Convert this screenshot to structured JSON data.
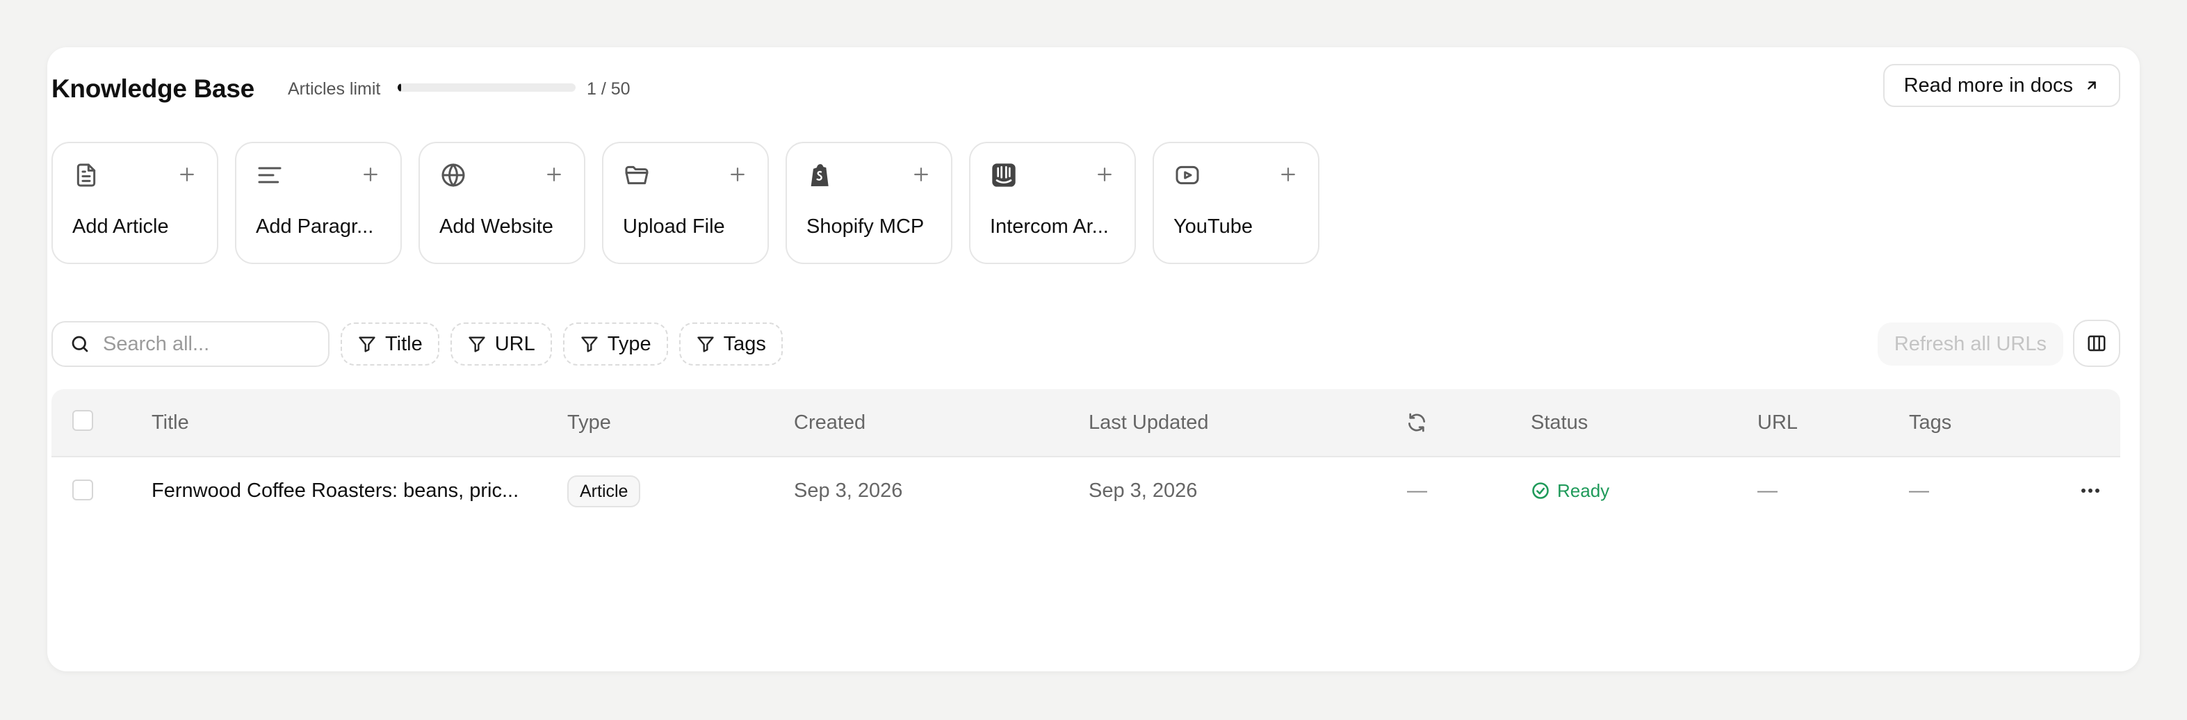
{
  "header": {
    "title": "Knowledge Base",
    "limit_label": "Articles limit",
    "limit_count": "1 / 50",
    "limit_fraction": 0.02,
    "docs_button": "Read more in docs"
  },
  "sources": [
    {
      "label": "Add Article",
      "icon": "article-icon"
    },
    {
      "label": "Add Paragr...",
      "icon": "paragraph-icon"
    },
    {
      "label": "Add Website",
      "icon": "globe-icon"
    },
    {
      "label": "Upload File",
      "icon": "folder-icon"
    },
    {
      "label": "Shopify MCP",
      "icon": "shopify-icon"
    },
    {
      "label": "Intercom Ar...",
      "icon": "intercom-icon"
    },
    {
      "label": "YouTube",
      "icon": "youtube-icon"
    }
  ],
  "toolbar": {
    "search_placeholder": "Search all...",
    "filters": [
      "Title",
      "URL",
      "Type",
      "Tags"
    ],
    "refresh_button": "Refresh all URLs"
  },
  "table": {
    "columns": [
      "Title",
      "Type",
      "Created",
      "Last Updated",
      "",
      "Status",
      "URL",
      "Tags"
    ],
    "rows": [
      {
        "title": "Fernwood Coffee Roasters: beans, pric...",
        "type": "Article",
        "created": "Sep 3, 2026",
        "last_updated": "Sep 3, 2026",
        "sync": "—",
        "status": "Ready",
        "url": "—",
        "tags": "—"
      }
    ]
  },
  "colors": {
    "status_ready": "#1f9a5a",
    "background": "#f3f3f2"
  }
}
